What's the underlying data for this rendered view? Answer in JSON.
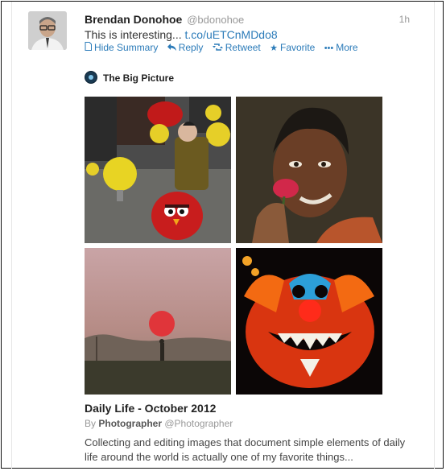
{
  "tweet": {
    "author_name": "Brendan Donohoe",
    "author_handle": "@bdonohoe",
    "timestamp": "1h",
    "text": "This is interesting...",
    "link": "t.co/uETCnMDdo8",
    "actions": [
      {
        "icon": "document-icon",
        "label": "Hide Summary"
      },
      {
        "icon": "reply-icon",
        "label": "Reply"
      },
      {
        "icon": "retweet-icon",
        "label": "Retweet"
      },
      {
        "icon": "star-icon",
        "label": "Favorite"
      },
      {
        "icon": "more-dots-icon",
        "label": "More"
      }
    ]
  },
  "card": {
    "source_name": "The Big Picture",
    "title": "Daily Life - October 2012",
    "by_prefix": "By",
    "by_name": "Photographer",
    "by_handle": "@Photographer",
    "description": "Collecting and editing images that document simple elements of daily life around the world is actually one of my favorite things..."
  },
  "colors": {
    "link": "#2b7bb9",
    "text": "#333333",
    "muted": "#999999"
  }
}
